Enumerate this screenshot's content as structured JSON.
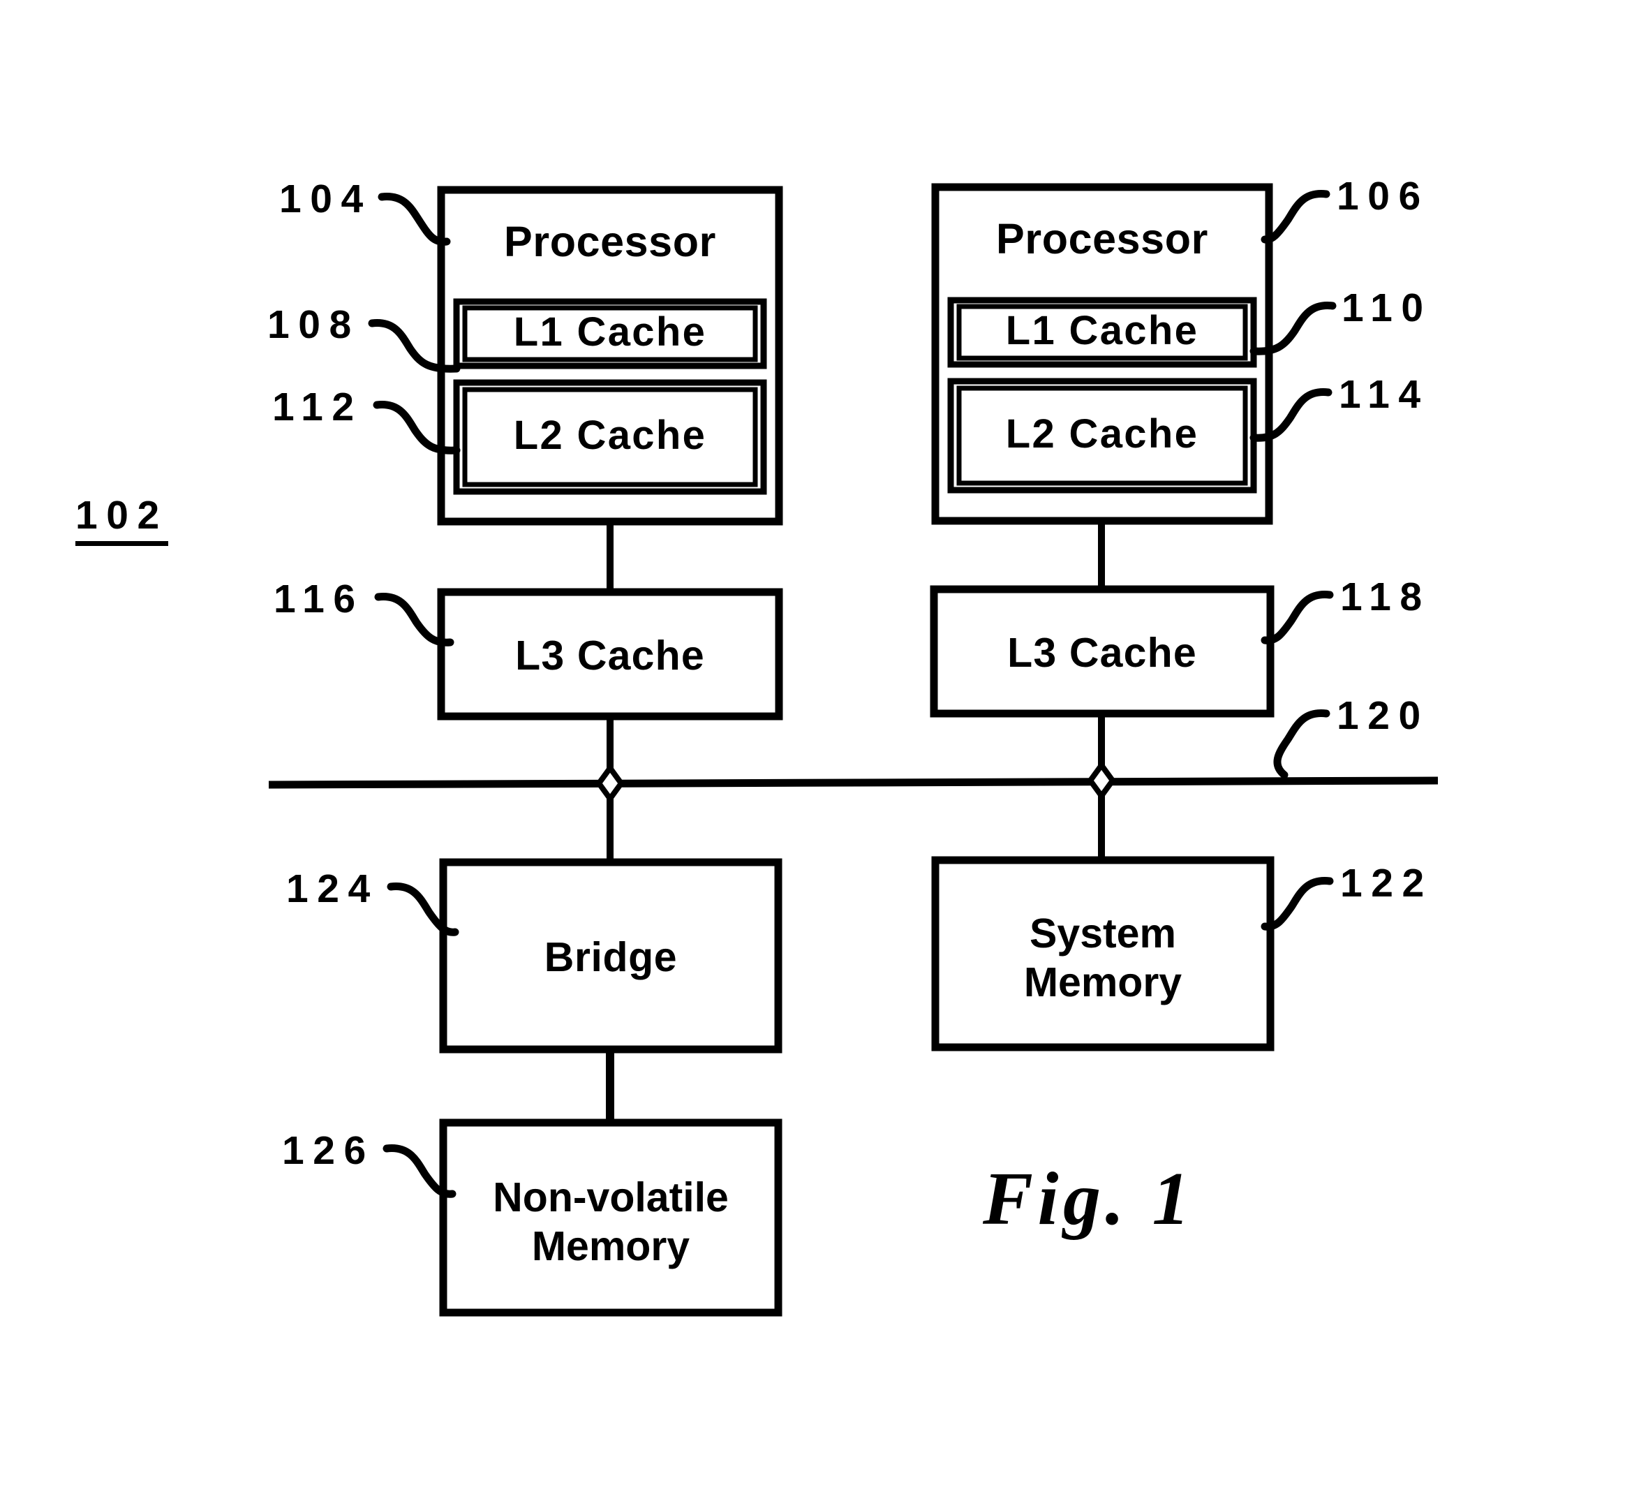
{
  "figure": {
    "caption": "Fig.  1",
    "system_ref": "102"
  },
  "blocks": {
    "processor_left": {
      "label": "Processor",
      "ref": "104",
      "l1": {
        "label": "L1 Cache",
        "ref": "108"
      },
      "l2": {
        "label": "L2 Cache",
        "ref": "112"
      }
    },
    "processor_right": {
      "label": "Processor",
      "ref": "106",
      "l1": {
        "label": "L1 Cache",
        "ref": "110"
      },
      "l2": {
        "label": "L2 Cache",
        "ref": "114"
      }
    },
    "l3_left": {
      "label": "L3 Cache",
      "ref": "116"
    },
    "l3_right": {
      "label": "L3 Cache",
      "ref": "118"
    },
    "bus": {
      "ref": "120"
    },
    "bridge": {
      "label": "Bridge",
      "ref": "124"
    },
    "system_memory": {
      "label_line1": "System",
      "label_line2": "Memory",
      "ref": "122"
    },
    "nonvolatile_memory": {
      "label_line1": "Non-volatile",
      "label_line2": "Memory",
      "ref": "126"
    }
  },
  "colors": {
    "ink": "#000000",
    "paper": "#ffffff"
  }
}
